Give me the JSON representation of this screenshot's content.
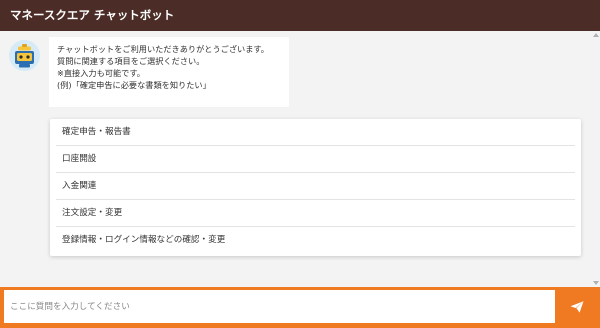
{
  "header": {
    "title": "マネースクエア チャットボット"
  },
  "bot": {
    "avatar_icon": "robot-mascot-icon",
    "message_lines": [
      "チャットボットをご利用いただきありがとうございます。",
      "質問に関連する項目をご選択ください。",
      "※直接入力も可能です。",
      "(例)「確定申告に必要な書類を知りたい」"
    ]
  },
  "options": [
    {
      "label": "確定申告・報告書"
    },
    {
      "label": "口座開設"
    },
    {
      "label": "入金関連"
    },
    {
      "label": "注文設定・変更"
    },
    {
      "label": "登録情報・ログイン情報などの確認・変更"
    }
  ],
  "input": {
    "placeholder": "ここに質問を入力してください",
    "value": ""
  },
  "send": {
    "icon": "send-paper-plane-icon"
  },
  "colors": {
    "header_bg": "#4b2c26",
    "accent": "#ef7a22",
    "chat_bg": "#f3f3f3"
  }
}
